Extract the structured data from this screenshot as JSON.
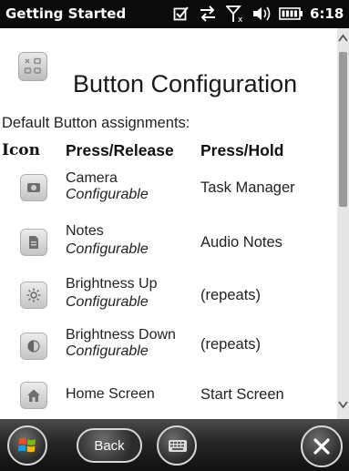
{
  "status_bar": {
    "app_title": "Getting Started",
    "time": "6:18",
    "icons": [
      "checkbox-icon",
      "sync-arrows-icon",
      "signal-off-icon",
      "volume-icon",
      "battery-icon"
    ]
  },
  "header": {
    "title": "Button Configuration",
    "subtitle": "Default Button assignments:"
  },
  "columns": {
    "icon": "Icon",
    "press_release": "Press/Release",
    "press_hold": "Press/Hold"
  },
  "rows": [
    {
      "icon": "camera-icon",
      "name": "Camera",
      "sub": "Configurable",
      "hold": "Task Manager"
    },
    {
      "icon": "notes-icon",
      "name": "Notes",
      "sub": "Configurable",
      "hold": "Audio Notes"
    },
    {
      "icon": "brightness-up-icon",
      "name": "Brightness Up",
      "sub": "Configurable",
      "hold": "(repeats)"
    },
    {
      "icon": "brightness-down-icon",
      "name": "Brightness Down",
      "sub": "Configurable",
      "hold": "(repeats)"
    },
    {
      "icon": "home-icon",
      "name": "Home Screen",
      "sub": "",
      "hold": "Start Screen"
    }
  ],
  "bottom_bar": {
    "back_label": "Back",
    "icons": [
      "windows-start-icon",
      "keyboard-icon",
      "close-icon"
    ]
  },
  "colors": {
    "status_bar_bg": "#0b0b0b",
    "bottom_bar_bg": "#262626",
    "scrollbar_thumb": "#9a9a9a"
  }
}
